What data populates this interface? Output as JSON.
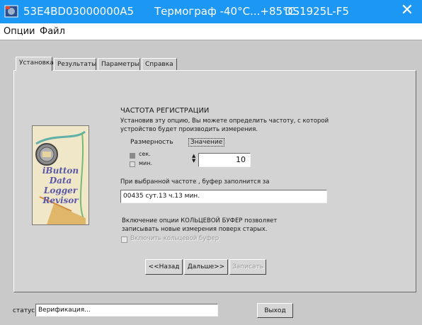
{
  "window": {
    "serial": "53E4BD03000000A5",
    "device_name": "Термограф -40°C...+85°C",
    "model": "DS1925L-F5",
    "close_glyph": "✕"
  },
  "menu": [
    "Опции",
    "Файл"
  ],
  "tabs": [
    "Установка",
    "Результаты",
    "Параметры",
    "Справка"
  ],
  "panel": {
    "heading": "ЧАСТОТА РЕГИСТРАЦИИ",
    "description_lines": [
      "Установив эту опцию, Вы можете определить частоту, с которой",
      "устройство будет производить измерения."
    ],
    "dimension_label": "Размерность",
    "value_label": "Значение",
    "units": [
      "сек.",
      "мин."
    ],
    "selected_unit": "сек.",
    "value": "10",
    "fill_text": "При выбранной частоте , буфер заполнится за",
    "fill_value": "00435 сут.13 ч.13 мин.",
    "ring_buffer_lines": [
      "Включение опции КОЛЬЦЕВОЙ БУФЕР позволяет",
      "записывать новые измерения поверх старых."
    ],
    "ring_buffer_checkbox": "Включить кольцевой буфер",
    "ring_buffer_checked": false,
    "buttons": {
      "back": "<<Назад",
      "next": "Дальше>>",
      "write": "Записать"
    },
    "logo_words": [
      "iButton",
      "Data",
      "Logger",
      "Revisor"
    ]
  },
  "status": {
    "label": "статус",
    "value": "Верификация...",
    "exit": "Выход"
  },
  "colors": {
    "titlebar": "#1d97f4",
    "panel": "#d3d3d3",
    "window": "#c9c9c9"
  }
}
